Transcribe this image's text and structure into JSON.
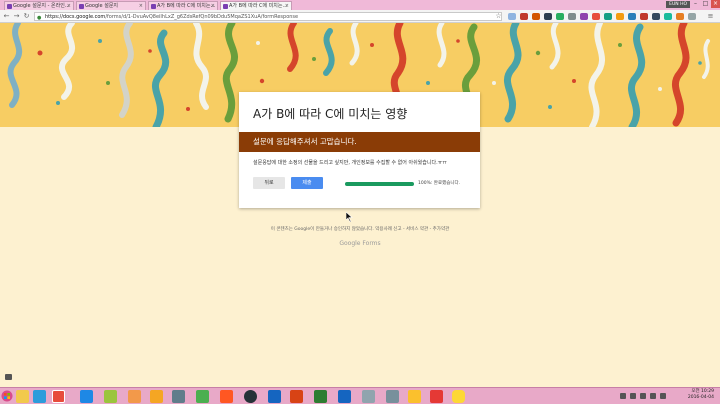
{
  "browser": {
    "tabs": [
      {
        "label": "Google 설문지 - 온라인..."
      },
      {
        "label": "Google 설문지"
      },
      {
        "label": "A가 B에 따라 C에 미치는..."
      },
      {
        "label": "A가 B에 따라 C에 미치는..."
      }
    ],
    "user_chip": "EUN HO",
    "url_host": "https://docs.google.com",
    "url_path": "/forms/d/1-DvuAvQ8eiIhLxZ_g6ZdsRefQn09bDdu5MqaZS1XuA/formResponse"
  },
  "form": {
    "title": "A가 B에 따라 C에 미치는 영향",
    "confirmation": "설문에 응답해주셔서 고맙습니다.",
    "message": "설문응답에 대한 소정의 선물을 드리고 싶지만, 개인정보를 수집할 수 없어 아쉬웠습니다.ㅠㅠ",
    "back_label": "뒤로",
    "submit_label": "제출",
    "progress_text": "100%: 완료했습니다.",
    "progress_fraction": 1.0
  },
  "footer": {
    "note": "이 콘텐츠는 Google이 만들거나 승인하지 않았습니다. 악용사례 신고 - 서비스 약관 - 추가약관",
    "brand": "Google Forms"
  },
  "taskbar": {
    "time": "오전 10:29",
    "date": "2016-04-04"
  },
  "colors": {
    "banner": "#f7cd63",
    "confirm_band": "#8a3c06",
    "submit": "#4a8cf0",
    "progress": "#1a9a5f",
    "page_bg": "#fdf1d0"
  }
}
